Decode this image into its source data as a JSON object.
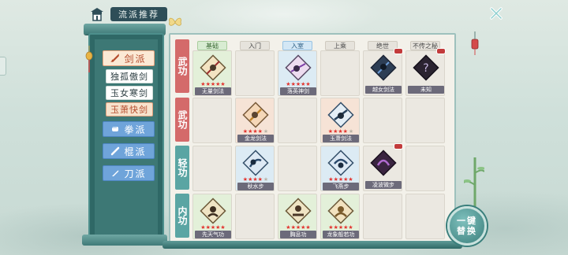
{
  "header": {
    "title": "流派推荐"
  },
  "sidebar": {
    "categories": [
      {
        "label": "剑派",
        "icon": "sword-icon",
        "active": true
      },
      {
        "label": "拳派",
        "icon": "fist-icon"
      },
      {
        "label": "棍派",
        "icon": "staff-icon"
      },
      {
        "label": "刀派",
        "icon": "blade-icon"
      }
    ],
    "subs": [
      {
        "label": "独孤傲剑"
      },
      {
        "label": "玉女寒剑"
      },
      {
        "label": "玉萧快剑",
        "active": true
      }
    ]
  },
  "tiers": [
    "基础",
    "入门",
    "入室",
    "上乘",
    "绝世",
    "不传之秘"
  ],
  "rows": [
    {
      "label": "武功"
    },
    {
      "label": "武功"
    },
    {
      "label": "轻功"
    },
    {
      "label": "内功"
    }
  ],
  "items": [
    {
      "name": "无量剑法",
      "stars": 5
    },
    {
      "name": "落英神剑",
      "stars": 5
    },
    {
      "name": "越女剑法",
      "stars": 0
    },
    {
      "name": "未知",
      "stars": 0
    },
    {
      "name": "金龙剑法",
      "stars": 4
    },
    {
      "name": "玉萧剑法",
      "stars": 4
    },
    {
      "name": "秋水步",
      "stars": 4
    },
    {
      "name": "飞燕步",
      "stars": 5
    },
    {
      "name": "凌波微步",
      "stars": 0
    },
    {
      "name": "先天气功",
      "stars": 5
    },
    {
      "name": "胸息功",
      "stars": 5
    },
    {
      "name": "龙象般若功",
      "stars": 5
    }
  ],
  "switch_button": {
    "line1": "一键",
    "line2": "替换"
  },
  "colors": {
    "accent_red": "#d46a6a",
    "accent_teal": "#5aa5a3",
    "panel_teal": "#2f6866"
  }
}
